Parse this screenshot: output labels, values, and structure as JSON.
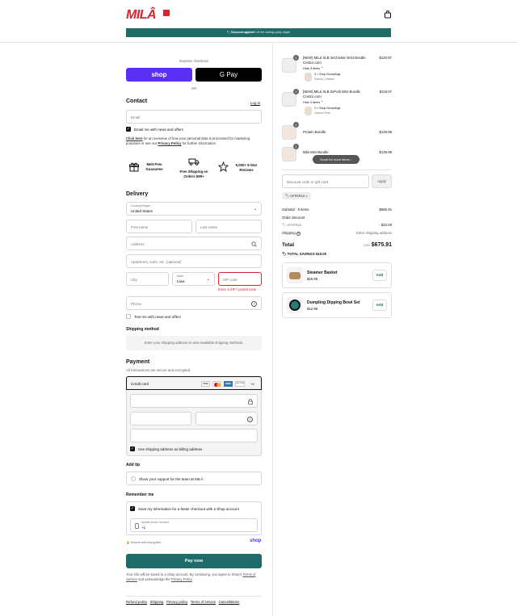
{
  "brand": {
    "logo_text": "MILÂ",
    "accent": "#d9232d",
    "primary": "#1f6b67"
  },
  "header": {
    "cart_icon": "shopping-bag-icon"
  },
  "banner": {
    "bold": "Discount applied!",
    "rest": "Let the savings party begin!"
  },
  "express": {
    "title": "Express checkout",
    "shop_label": "shop",
    "gpay_label": "G Pay",
    "or_label": "OR"
  },
  "contact": {
    "title": "Contact",
    "login": "Log in",
    "email_placeholder": "Email",
    "email_news": "Email me with news and offers",
    "privacy_click": "Click here",
    "privacy_mid": " for an overview of how your personal data is processed for marketing purposes or see our ",
    "privacy_link": "Privacy Policy",
    "privacy_end": " for further information."
  },
  "perks": [
    {
      "icon": "gift-icon",
      "label": "Melt-Free Guarantee"
    },
    {
      "icon": "truck-icon",
      "label": "Free Shipping on Orders $99+"
    },
    {
      "icon": "star-icon",
      "label": "5,000+ 5-Star Reviews"
    }
  ],
  "delivery": {
    "title": "Delivery",
    "country_label": "Country/Region",
    "country_value": "United States",
    "first_name": "First name",
    "last_name": "Last name",
    "address": "Address",
    "apartment": "Apartment, suite, etc. (optional)",
    "city": "City",
    "state_label": "State",
    "state_value": "Iowa",
    "zip": "ZIP code",
    "zip_error": "Enter a ZIP / postal code",
    "phone": "Phone",
    "sms": "Text me with news and offers"
  },
  "shipping": {
    "title": "Shipping method",
    "note": "Enter your shipping address to view available shipping methods."
  },
  "payment": {
    "title": "Payment",
    "subtitle": "All transactions are secure and encrypted.",
    "method": "Credit card",
    "cards": [
      "VISA",
      "MC",
      "AMEX",
      "DISCOVER",
      "+4"
    ],
    "billing": "Use shipping address as billing address"
  },
  "tip": {
    "title": "Add tip",
    "option": "Show your support for the team at MILÂ"
  },
  "remember": {
    "title": "Remember me",
    "save": "Save my information for a faster checkout with a Shop account",
    "phone_label": "Mobile phone number",
    "phone_value": "+1",
    "secure": "Secure and encrypted",
    "shop": "shop"
  },
  "pay": {
    "label": "Pay now"
  },
  "legal": {
    "text1": "Your info will be saved to a Shop account. By continuing, you agree to Shop's ",
    "tos": "Terms of Service",
    "text2": " and acknowledge the ",
    "privacy": "Privacy Policy",
    "end": "."
  },
  "footer": [
    "Refund policy",
    "Shipping",
    "Privacy policy",
    "Terms of service",
    "Cancellations"
  ],
  "order": {
    "items": [
      {
        "qty": "1",
        "name": "[NEW] MILá XLB 3xChicken 50ct Bundle Costco.com",
        "price": "$120.97",
        "hide": "Hide 3 items",
        "sub_qty": "3 ×",
        "sub_name": "Soup Dumplings",
        "sub_variant": "Savory Chicken"
      },
      {
        "qty": "1",
        "name": "[NEW] MILá XLB 3xPork 50ct Bundle Costco.com",
        "price": "$119.97",
        "hide": "Hide 3 items",
        "sub_qty": "3 ×",
        "sub_name": "Soup Dumplings",
        "sub_variant": "Classic Pork"
      },
      {
        "qty": "1",
        "name": "Protein Bundle",
        "price": "$149.99"
      },
      {
        "qty": "1",
        "name": "Mila Mini Bundle",
        "price": "$139.99"
      }
    ],
    "scroll_hint": "Scroll for more items",
    "discount_placeholder": "Discount code or gift card",
    "apply": "Apply",
    "code": "OFFER10",
    "subtotal_label": "Subtotal · 5 items",
    "subtotal": "$685.91",
    "order_discount": "Order discount",
    "discount_code": "OFFER10",
    "discount_value": "- $10.00",
    "shipping_label": "Shipping",
    "shipping_value": "Enter shipping address",
    "total_label": "Total",
    "currency": "USD",
    "total": "$675.91",
    "savings_label": "TOTAL SAVINGS",
    "savings": "$10.00"
  },
  "upsells": [
    {
      "name": "Steamer Basket",
      "price": "$29.99",
      "add": "Add"
    },
    {
      "name": "Dumpling Dipping Bowl Set",
      "price": "$12.99",
      "add": "Add"
    }
  ]
}
